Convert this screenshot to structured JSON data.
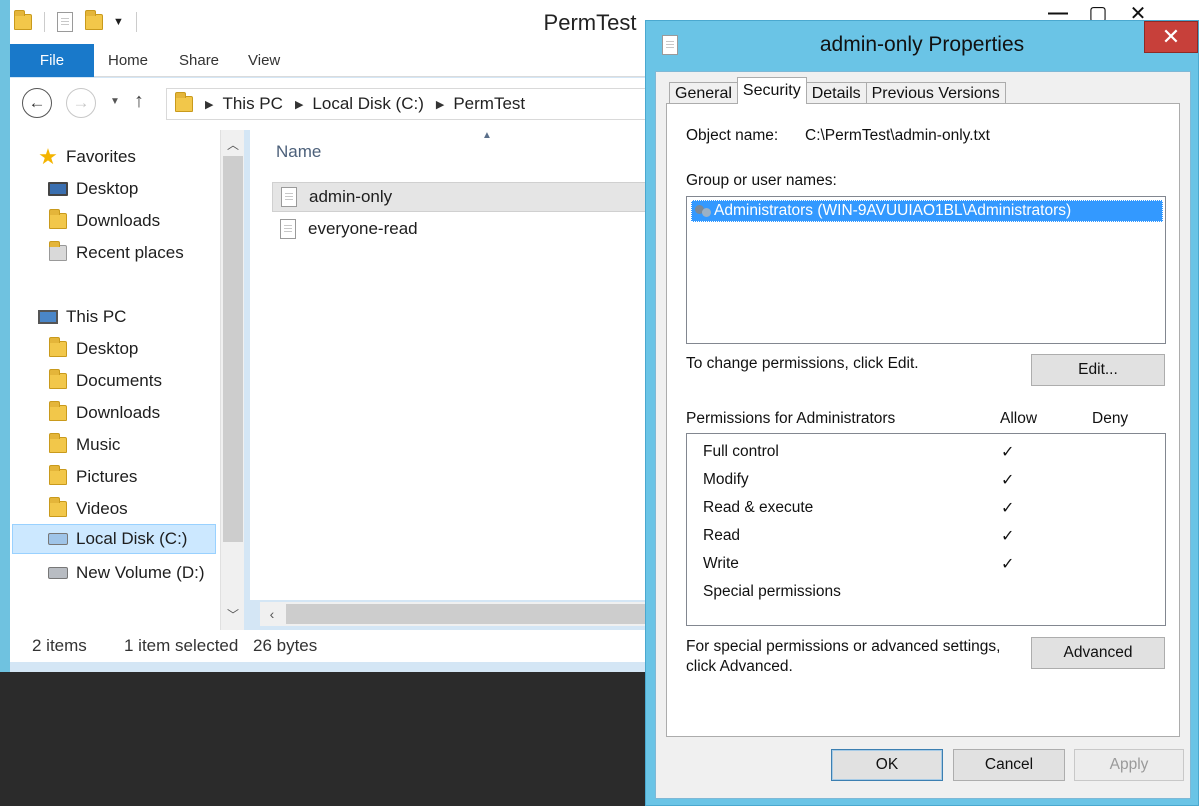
{
  "explorer": {
    "title": "PermTest",
    "ribbon_tabs": {
      "file": "File",
      "home": "Home",
      "share": "Share",
      "view": "View"
    },
    "breadcrumb": [
      "This PC",
      "Local Disk (C:)",
      "PermTest"
    ],
    "nav": {
      "favorites": "Favorites",
      "desktop": "Desktop",
      "downloads": "Downloads",
      "recent": "Recent places",
      "this_pc": "This PC",
      "pc_desktop": "Desktop",
      "pc_documents": "Documents",
      "pc_downloads": "Downloads",
      "pc_music": "Music",
      "pc_pictures": "Pictures",
      "pc_videos": "Videos",
      "local_disk": "Local Disk (C:)",
      "new_volume": "New Volume (D:)"
    },
    "column_name": "Name",
    "files": [
      "admin-only",
      "everyone-read"
    ],
    "status": {
      "items": "2 items",
      "selected": "1 item selected",
      "size": "26 bytes"
    }
  },
  "dialog": {
    "title": "admin-only Properties",
    "tabs": [
      "General",
      "Security",
      "Details",
      "Previous Versions"
    ],
    "object_name_label": "Object name:",
    "object_name_value": "C:\\PermTest\\admin-only.txt",
    "group_label": "Group or user names:",
    "group_entry": "Administrators (WIN-9AVUUIAO1BL\\Administrators)",
    "change_hint": "To change permissions, click Edit.",
    "edit_button": "Edit...",
    "perm_header": "Permissions for Administrators",
    "allow_header": "Allow",
    "deny_header": "Deny",
    "permissions": [
      {
        "name": "Full control",
        "allow": "✓"
      },
      {
        "name": "Modify",
        "allow": "✓"
      },
      {
        "name": "Read & execute",
        "allow": "✓"
      },
      {
        "name": "Read",
        "allow": "✓"
      },
      {
        "name": "Write",
        "allow": "✓"
      },
      {
        "name": "Special permissions",
        "allow": ""
      }
    ],
    "special_hint_line1": "For special permissions or advanced settings,",
    "special_hint_line2": "click Advanced.",
    "advanced_button": "Advanced",
    "ok_button": "OK",
    "cancel_button": "Cancel",
    "apply_button": "Apply"
  }
}
